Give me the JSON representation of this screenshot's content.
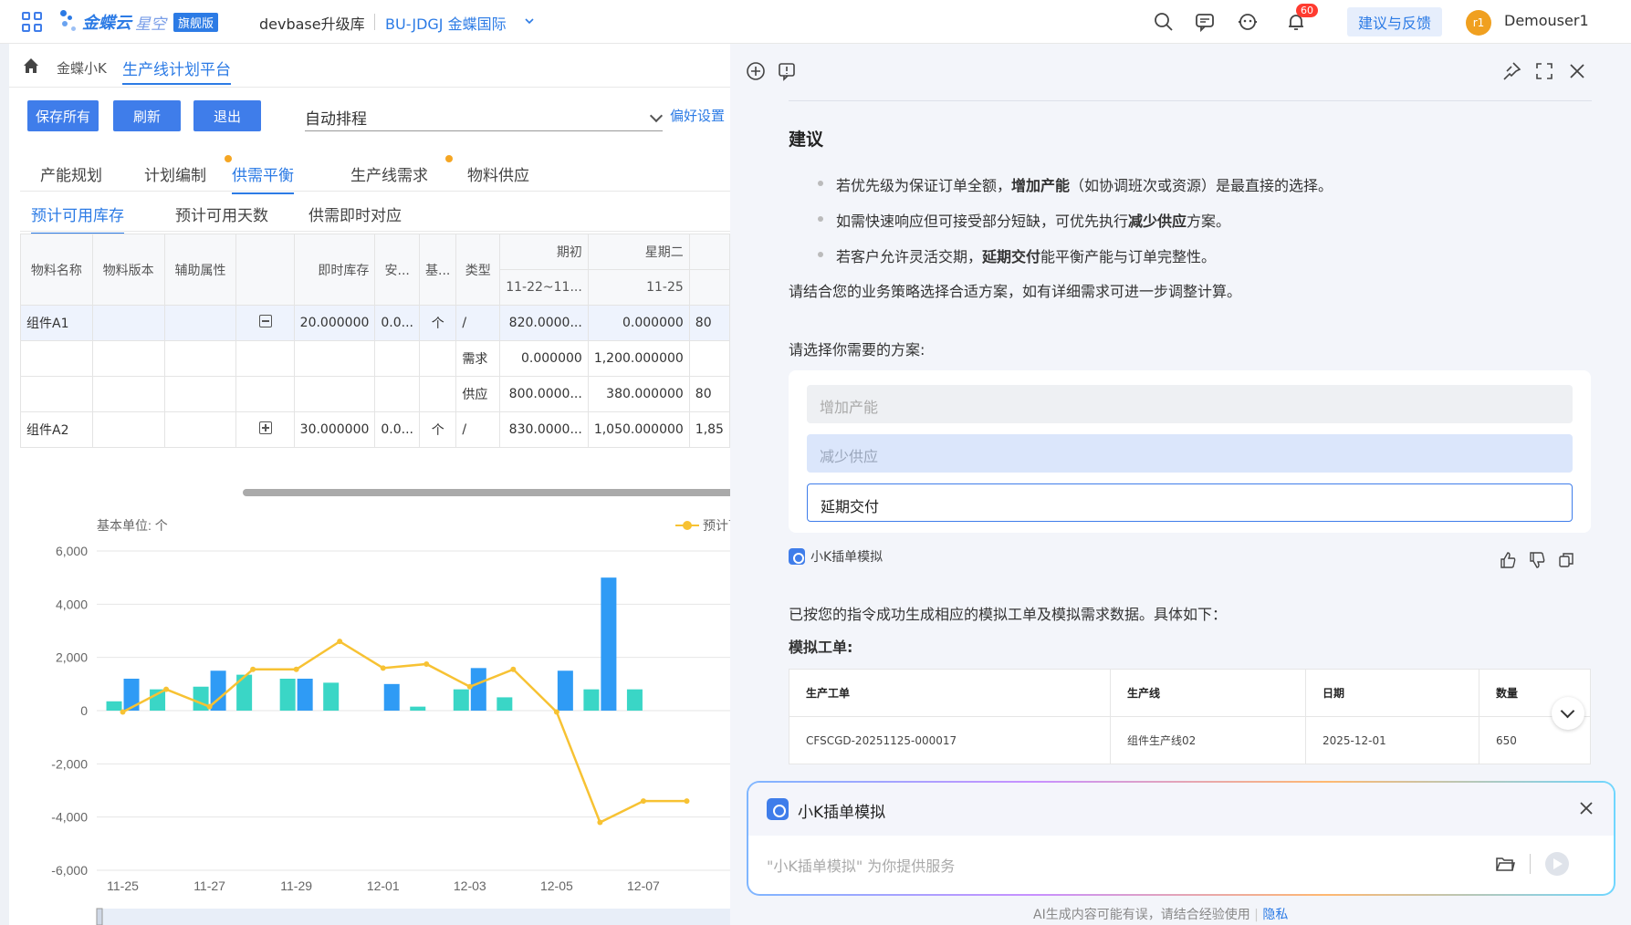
{
  "topbar": {
    "logo_name": "金蝶云",
    "logo_name2": "星空",
    "logo_badge": "旗舰版",
    "database": "devbase升级库",
    "org": "BU-JDGJ 金蝶国际",
    "bell_count": "60",
    "feedback": "建议与反馈",
    "avatar_initials": "r1",
    "username": "Demouser1",
    "brand_color": "#2c7be5"
  },
  "breadcrumb": {
    "item1": "金蝶小K",
    "item2": "生产线计划平台"
  },
  "toolbar": {
    "save_all": "保存所有",
    "refresh": "刷新",
    "exit": "退出",
    "schedule_select": "自动排程",
    "preferences": "偏好设置"
  },
  "tabs": [
    {
      "label": "产能规划"
    },
    {
      "label": "计划编制"
    },
    {
      "label": "供需平衡"
    },
    {
      "label": "生产线需求"
    },
    {
      "label": "物料供应"
    }
  ],
  "subtabs": [
    {
      "label": "预计可用库存"
    },
    {
      "label": "预计可用天数"
    },
    {
      "label": "供需即时对应"
    }
  ],
  "grid": {
    "headers": {
      "material": "物料名称",
      "version": "物料版本",
      "aux": "辅助属性",
      "stock": "即时库存",
      "safety": "安...",
      "base": "基...",
      "type": "类型",
      "period_start": "期初",
      "tuesday": "星期二",
      "range": "11-22~11...",
      "date": "11-25"
    },
    "rows": [
      {
        "material": "组件A1",
        "stock": "20.000000",
        "safety": "0.0...",
        "base": "个",
        "type": "/",
        "c1": "820.0000...",
        "c2": "0.000000",
        "c3": "80"
      },
      {
        "type": "需求",
        "c1": "0.000000",
        "c2": "1,200.000000"
      },
      {
        "type": "供应",
        "c1": "800.0000...",
        "c2": "380.000000",
        "c3": "80"
      },
      {
        "material": "组件A2",
        "stock": "30.000000",
        "safety": "0.0...",
        "base": "个",
        "type": "/",
        "c1": "830.0000...",
        "c2": "1,050.000000",
        "c3": "1,85"
      }
    ]
  },
  "chart_data": {
    "type": "bar",
    "unit_label": "基本单位: 个",
    "legend_fragment": "预计可",
    "ylim": [
      -6000,
      6000
    ],
    "y_ticks": [
      "6,000",
      "4,000",
      "2,000",
      "0",
      "-2,000",
      "-4,000",
      "-6,000"
    ],
    "x_ticks": [
      "11-25",
      "11-27",
      "11-29",
      "12-01",
      "12-03",
      "12-05",
      "12-07"
    ],
    "series": [
      {
        "type": "bar",
        "color": "#3ad6c6",
        "values": [
          350,
          800,
          900,
          1350,
          1200,
          1050,
          0,
          150,
          800,
          500,
          0,
          800,
          800,
          0
        ]
      },
      {
        "type": "bar",
        "color": "#2f9bf5",
        "values": [
          1200,
          0,
          1500,
          0,
          1200,
          0,
          1000,
          0,
          1600,
          0,
          1500,
          5000,
          0,
          0
        ]
      },
      {
        "type": "line",
        "color": "#f7c233",
        "values": [
          -50,
          800,
          150,
          1550,
          1550,
          2600,
          1600,
          1750,
          900,
          1550,
          -50,
          -4200,
          -3400,
          -3400
        ]
      }
    ]
  },
  "panel": {
    "suggestion_title": "建议",
    "bullets": [
      {
        "pre": "若优先级为保证订单全额，",
        "bold": "增加产能",
        "post": "（如协调班次或资源）是最直接的选择。"
      },
      {
        "pre": "如需快速响应但可接受部分短缺，可优先执行",
        "bold": "减少供应",
        "post": "方案。"
      },
      {
        "pre": "若客户允许灵活交期，",
        "bold": "延期交付",
        "post": "能平衡产能与订单完整性。"
      }
    ],
    "closing": "请结合您的业务策略选择合适方案，如有详细需求可进一步调整计算。",
    "choose_prompt": "请选择你需要的方案:",
    "options": [
      "增加产能",
      "减少供应",
      "延期交付"
    ],
    "plugin_name": "小K插单模拟",
    "result_text": "已按您的指令成功生成相应的模拟工单及模拟需求数据。具体如下：",
    "workorder_title": "模拟工单:",
    "workorder_headers": [
      "生产工单",
      "生产线",
      "日期",
      "数量"
    ],
    "workorder_rows": [
      [
        "CFSCGD-20251125-000017",
        "组件生产线02",
        "2025-12-01",
        "650"
      ]
    ],
    "input_title": "小K插单模拟",
    "input_placeholder": "\"小K插单模拟\" 为你提供服务",
    "disclaimer": "AI生成内容可能有误，请结合经验使用",
    "privacy": "隐私"
  }
}
